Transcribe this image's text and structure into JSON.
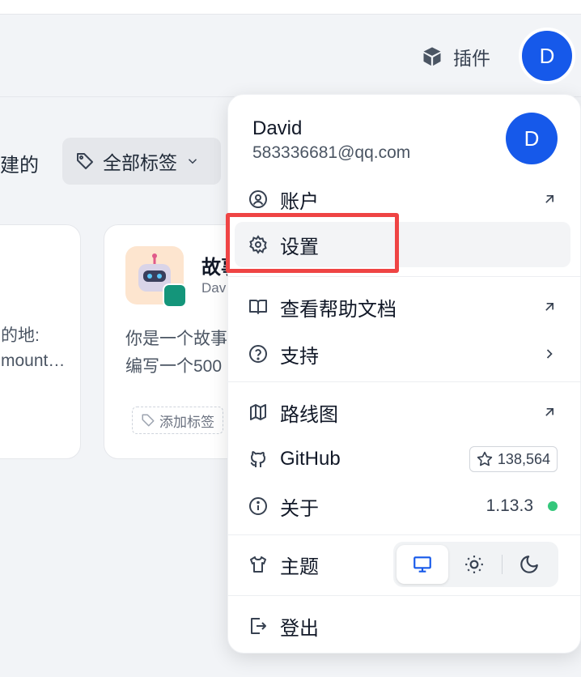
{
  "header": {
    "plugin_label": "插件",
    "avatar_letter": "D"
  },
  "toolbar": {
    "created_text": "建的",
    "tag_filter_label": "全部标签"
  },
  "cards": {
    "left": {
      "line1": "的地:",
      "line2": "mount…"
    },
    "mid": {
      "title": "故事",
      "author": "Dav",
      "desc_line1": "你是一个故事",
      "desc_line2": "编写一个500",
      "add_tag_label": "添加标签"
    }
  },
  "menu": {
    "user_name": "David",
    "user_email": "583336681@qq.com",
    "avatar_letter": "D",
    "items": {
      "account": "账户",
      "settings": "设置",
      "help_docs": "查看帮助文档",
      "support": "支持",
      "roadmap": "路线图",
      "github": "GitHub",
      "github_stars": "138,564",
      "about": "关于",
      "version": "1.13.3",
      "theme": "主题",
      "logout": "登出"
    },
    "theme_selected": "system"
  },
  "colors": {
    "accent": "#1659ea",
    "highlight_border": "#ef4444",
    "status_dot": "#34c77b",
    "bot_badge": "#14957a"
  }
}
